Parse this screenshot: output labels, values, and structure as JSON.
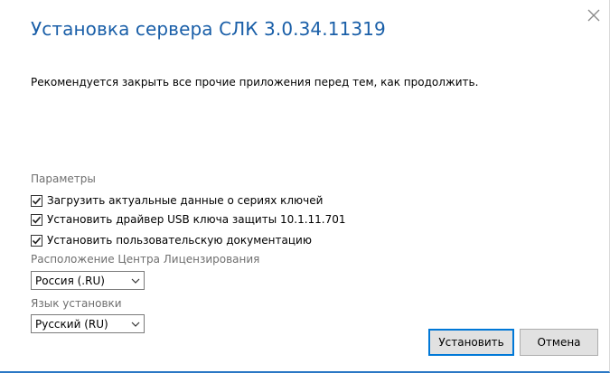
{
  "window": {
    "title": "Установка сервера СЛК 3.0.34.11319",
    "message": "Рекомендуется закрыть все прочие приложения перед тем, как продолжить."
  },
  "parameters": {
    "label": "Параметры",
    "options": [
      {
        "label": "Загрузить актуальные данные о сериях ключей",
        "checked": true
      },
      {
        "label": "Установить драйвер USB ключа защиты 10.1.11.701",
        "checked": true
      },
      {
        "label": "Установить пользовательскую документацию",
        "checked": true
      }
    ]
  },
  "license_center": {
    "label": "Расположение Центра Лицензирования",
    "selected": "Россия (.RU)"
  },
  "language": {
    "label": "Язык установки",
    "selected": "Русский (RU)"
  },
  "buttons": {
    "install": "Установить",
    "cancel": "Отмена"
  },
  "colors": {
    "title": "#1a5fa8",
    "accent": "#0078d7",
    "muted_label": "#6f6f6f"
  }
}
